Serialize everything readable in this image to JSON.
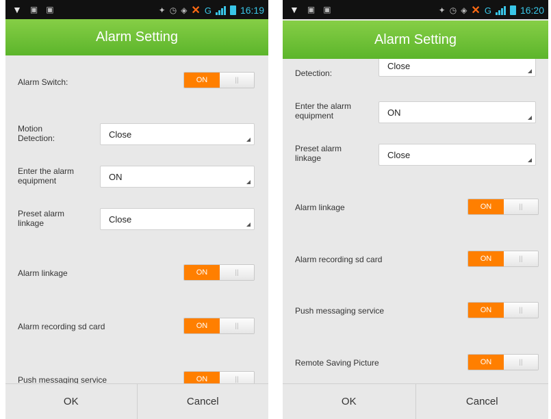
{
  "colors": {
    "accent_green": "#6cc137",
    "toggle_on": "#ff7f00",
    "status_blue": "#39c6e8"
  },
  "left": {
    "status_time": "16:19",
    "network": "G",
    "title": "Alarm Setting",
    "alarm_switch": {
      "label": "Alarm Switch:",
      "toggle": "ON"
    },
    "motion_detection": {
      "label": "Motion Detection:",
      "value": "Close"
    },
    "enter_alarm_equipment": {
      "label": "Enter the alarm equipment",
      "value": "ON"
    },
    "preset_alarm_linkage": {
      "label": "Preset alarm linkage",
      "value": "Close"
    },
    "alarm_linkage": {
      "label": "Alarm linkage",
      "toggle": "ON"
    },
    "alarm_recording_sd": {
      "label": "Alarm recording sd card",
      "toggle": "ON"
    },
    "push_messaging": {
      "label": "Push messaging service",
      "toggle": "ON"
    },
    "ok_label": "OK",
    "cancel_label": "Cancel"
  },
  "right": {
    "status_time": "16:20",
    "network": "G",
    "title": "Alarm Setting",
    "motion_detection": {
      "label": "Detection:",
      "value": "Close"
    },
    "enter_alarm_equipment": {
      "label": "Enter the alarm equipment",
      "value": "ON"
    },
    "preset_alarm_linkage": {
      "label": "Preset alarm linkage",
      "value": "Close"
    },
    "alarm_linkage": {
      "label": "Alarm linkage",
      "toggle": "ON"
    },
    "alarm_recording_sd": {
      "label": "Alarm recording sd card",
      "toggle": "ON"
    },
    "push_messaging": {
      "label": "Push messaging service",
      "toggle": "ON"
    },
    "remote_saving_picture": {
      "label": "Remote Saving Picture",
      "toggle": "ON"
    },
    "ok_label": "OK",
    "cancel_label": "Cancel"
  }
}
